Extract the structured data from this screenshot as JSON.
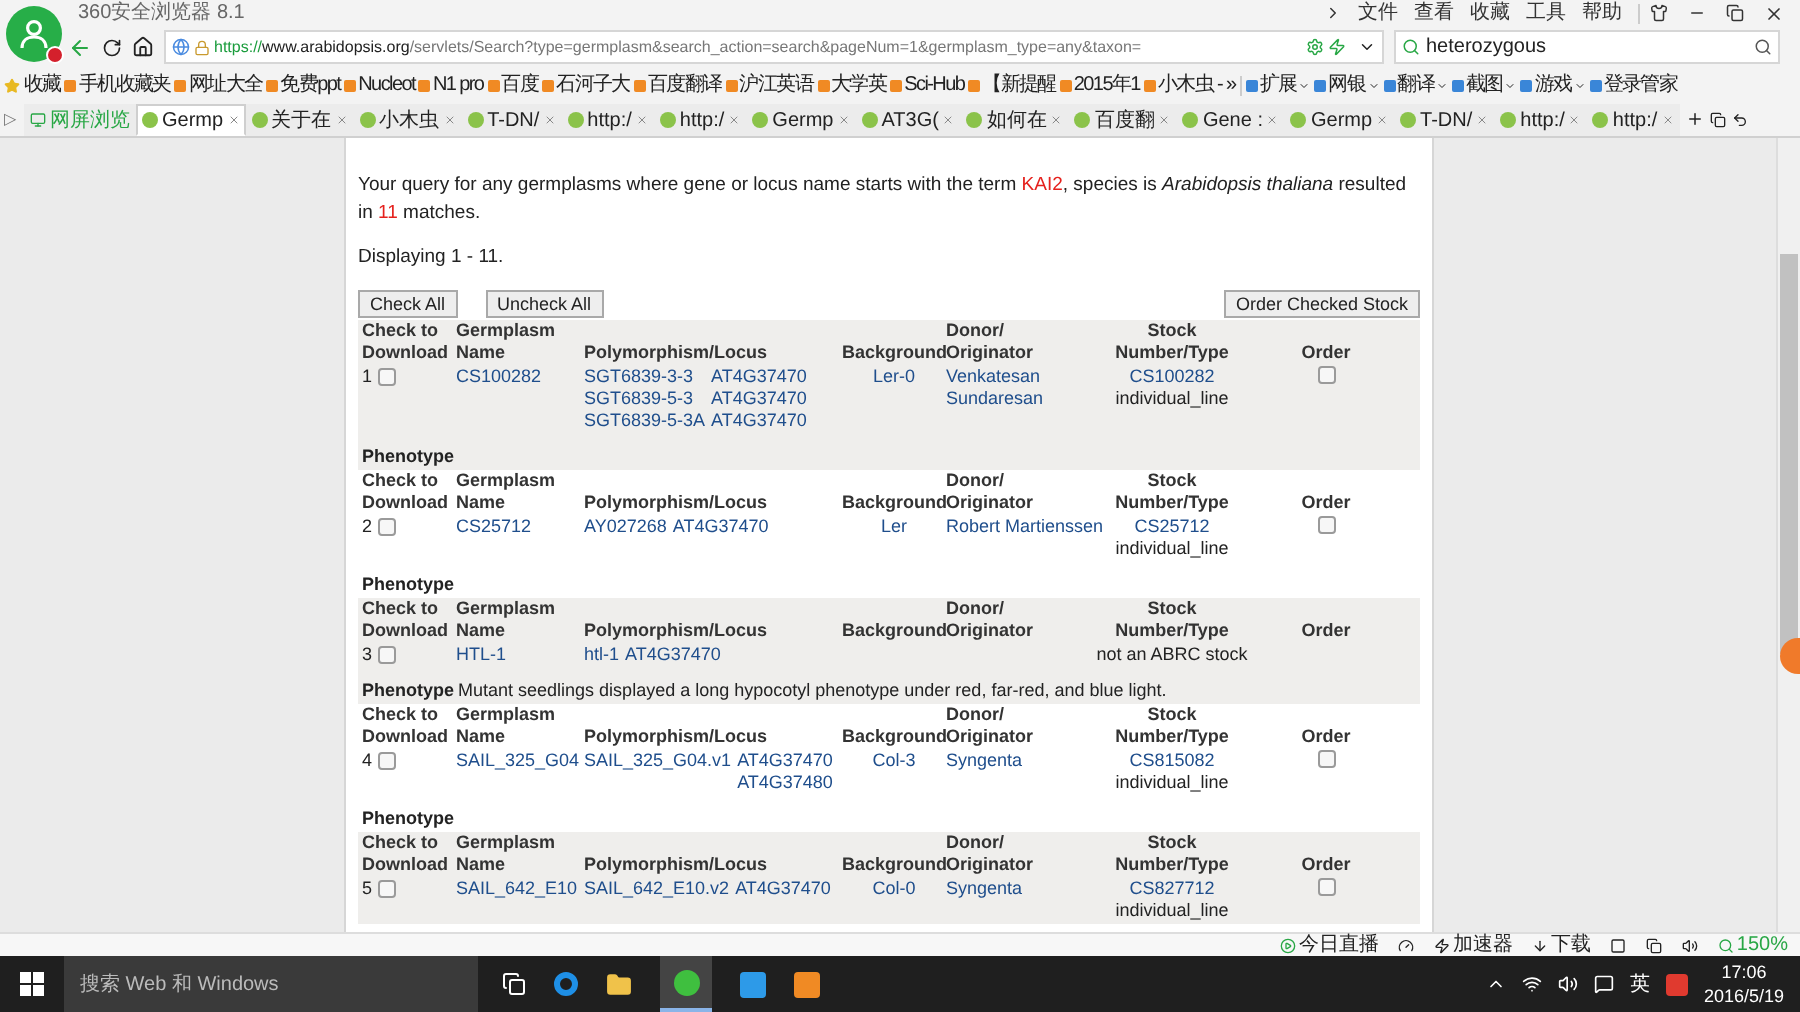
{
  "browser": {
    "title": "360安全浏览器 8.1",
    "menu": [
      "文件",
      "查看",
      "收藏",
      "工具",
      "帮助"
    ],
    "address": {
      "scheme": "https://",
      "host": "www.arabidopsis.org",
      "path": "/servlets/Search?type=germplasm&search_action=search&pageNum=1&germplasm_type=any&taxon="
    },
    "search": {
      "value": "heterozygous"
    },
    "bookmarks": [
      "收藏",
      "手机收藏夹",
      "网址大全",
      "免费ppt",
      "Nucleot",
      "N1 pro",
      "百度",
      "石河子大",
      "百度翻译",
      "沪江英语",
      "大学英",
      "Sci-Hub",
      "【新提醒",
      "2015年1",
      "小木虫 -"
    ],
    "more": "»",
    "tools": [
      "扩展",
      "网银",
      "翻译",
      "截图",
      "游戏",
      "登录管家"
    ],
    "sidebar_toggle": "▷",
    "tabs": [
      {
        "label": "网屏浏览",
        "selected": false,
        "kind": "pinned"
      },
      {
        "label": "Germp",
        "selected": true,
        "kind": "page"
      },
      {
        "label": "关于在",
        "selected": false,
        "kind": "page"
      },
      {
        "label": "小木虫",
        "selected": false,
        "kind": "page"
      },
      {
        "label": "T-DN/",
        "selected": false,
        "kind": "page"
      },
      {
        "label": "http:/",
        "selected": false,
        "kind": "page"
      },
      {
        "label": "http:/",
        "selected": false,
        "kind": "page"
      },
      {
        "label": "Germp",
        "selected": false,
        "kind": "page"
      },
      {
        "label": "AT3G(",
        "selected": false,
        "kind": "page"
      },
      {
        "label": "如何在",
        "selected": false,
        "kind": "page"
      },
      {
        "label": "百度翻",
        "selected": false,
        "kind": "page"
      },
      {
        "label": "Gene :",
        "selected": false,
        "kind": "page"
      },
      {
        "label": "Germp",
        "selected": false,
        "kind": "page"
      },
      {
        "label": "T-DN/",
        "selected": false,
        "kind": "page"
      },
      {
        "label": "http:/",
        "selected": false,
        "kind": "page"
      },
      {
        "label": "http:/",
        "selected": false,
        "kind": "page"
      }
    ]
  },
  "page": {
    "query": [
      {
        "kind": "plain",
        "text": "Your query for any germplasms where gene or locus name starts with the term "
      },
      {
        "kind": "term",
        "text": "KAI2"
      },
      {
        "kind": "plain",
        "text": ", species is "
      },
      {
        "kind": "italic",
        "text": "Arabidopsis thaliana"
      },
      {
        "kind": "plain",
        "text": " resulted in "
      },
      {
        "kind": "term",
        "text": "11"
      },
      {
        "kind": "plain",
        "text": " matches."
      }
    ],
    "displaying": "Displaying 1 - 11.",
    "buttons": {
      "check_all": "Check All",
      "uncheck_all": "Uncheck All",
      "order": "Order Checked Stock"
    },
    "rows": [
      {
        "index": "1",
        "headers": [
          [
            "Check to",
            "Download"
          ],
          [
            "Germplasm",
            "Name"
          ],
          [
            "Polymorphism/Locus"
          ],
          [
            "Background"
          ],
          [
            "Donor/",
            "Originator"
          ],
          [
            "Stock",
            "Number/Type"
          ],
          [
            "Order"
          ]
        ],
        "checked": false,
        "name": "CS100282",
        "polymorphisms": [
          {
            "allele": "SGT6839-3-3",
            "loci": [
              "AT4G37470"
            ]
          },
          {
            "allele": "SGT6839-5-3",
            "loci": [
              "AT4G37470"
            ]
          },
          {
            "allele": "SGT6839-5-3A",
            "loci": [
              "AT4G37470"
            ]
          }
        ],
        "background": "Ler-0",
        "donor": [
          "Venkatesan",
          "Sundaresan"
        ],
        "stock_number": "CS100282",
        "stock_type": "individual_line",
        "order_checked": false,
        "phenotype": {
          "label": "Phenotype"
        }
      },
      {
        "index": "2",
        "headers": [
          [
            "Check to",
            "Download"
          ],
          [
            "Germplasm",
            "Name"
          ],
          [
            "Polymorphism/Locus"
          ],
          [
            "Background"
          ],
          [
            "Donor/",
            "Originator"
          ],
          [
            "Stock",
            "Number/Type"
          ],
          [
            "Order"
          ]
        ],
        "checked": false,
        "name": "CS25712",
        "polymorphisms": [
          {
            "allele": "AY027268",
            "loci": [
              "AT4G37470"
            ]
          }
        ],
        "background": "Ler",
        "donor": [
          "Robert Martienssen"
        ],
        "stock_number": "CS25712",
        "stock_type": "individual_line",
        "order_checked": false,
        "phenotype": {
          "label": "Phenotype"
        }
      },
      {
        "index": "3",
        "headers": [
          [
            "Check to",
            "Download"
          ],
          [
            "Germplasm",
            "Name"
          ],
          [
            "Polymorphism/Locus"
          ],
          [
            "Background"
          ],
          [
            "Donor/",
            "Originator"
          ],
          [
            "Stock",
            "Number/Type"
          ],
          [
            "Order"
          ]
        ],
        "checked": false,
        "name": "HTL-1",
        "polymorphisms": [
          {
            "allele": "htl-1",
            "loci": [
              "AT4G37470"
            ]
          }
        ],
        "stock_type": "not an ABRC stock",
        "phenotype": {
          "label": "Phenotype",
          "text": "Mutant seedlings displayed a long hypocotyl phenotype under red, far-red, and blue light."
        }
      },
      {
        "index": "4",
        "headers": [
          [
            "Check to",
            "Download"
          ],
          [
            "Germplasm",
            "Name"
          ],
          [
            "Polymorphism/Locus"
          ],
          [
            "Background"
          ],
          [
            "Donor/",
            "Originator"
          ],
          [
            "Stock",
            "Number/Type"
          ],
          [
            "Order"
          ]
        ],
        "checked": false,
        "name": "SAIL_325_G04",
        "polymorphisms": [
          {
            "allele": "SAIL_325_G04.v1",
            "loci": [
              "AT4G37470",
              "AT4G37480"
            ]
          }
        ],
        "background": "Col-3",
        "donor": [
          "Syngenta"
        ],
        "stock_number": "CS815082",
        "stock_type": "individual_line",
        "order_checked": false,
        "phenotype": {
          "label": "Phenotype"
        }
      },
      {
        "index": "5",
        "headers": [
          [
            "Check to",
            "Download"
          ],
          [
            "Germplasm",
            "Name"
          ],
          [
            "Polymorphism/Locus"
          ],
          [
            "Background"
          ],
          [
            "Donor/",
            "Originator"
          ],
          [
            "Stock",
            "Number/Type"
          ],
          [
            "Order"
          ]
        ],
        "checked": false,
        "name": "SAIL_642_E10",
        "polymorphisms": [
          {
            "allele": "SAIL_642_E10.v2",
            "loci": [
              "AT4G37470"
            ]
          }
        ],
        "background": "Col-0",
        "donor": [
          "Syngenta"
        ],
        "stock_number": "CS827712",
        "stock_type": "individual_line",
        "order_checked": false
      }
    ]
  },
  "status_bar": {
    "items": [
      "今日直播",
      "加速器",
      "下载"
    ],
    "zoom": "150%"
  },
  "taskbar": {
    "search_placeholder": "搜索 Web 和 Windows",
    "ime": "英",
    "time": "17:06",
    "date": "2016/5/19"
  }
}
